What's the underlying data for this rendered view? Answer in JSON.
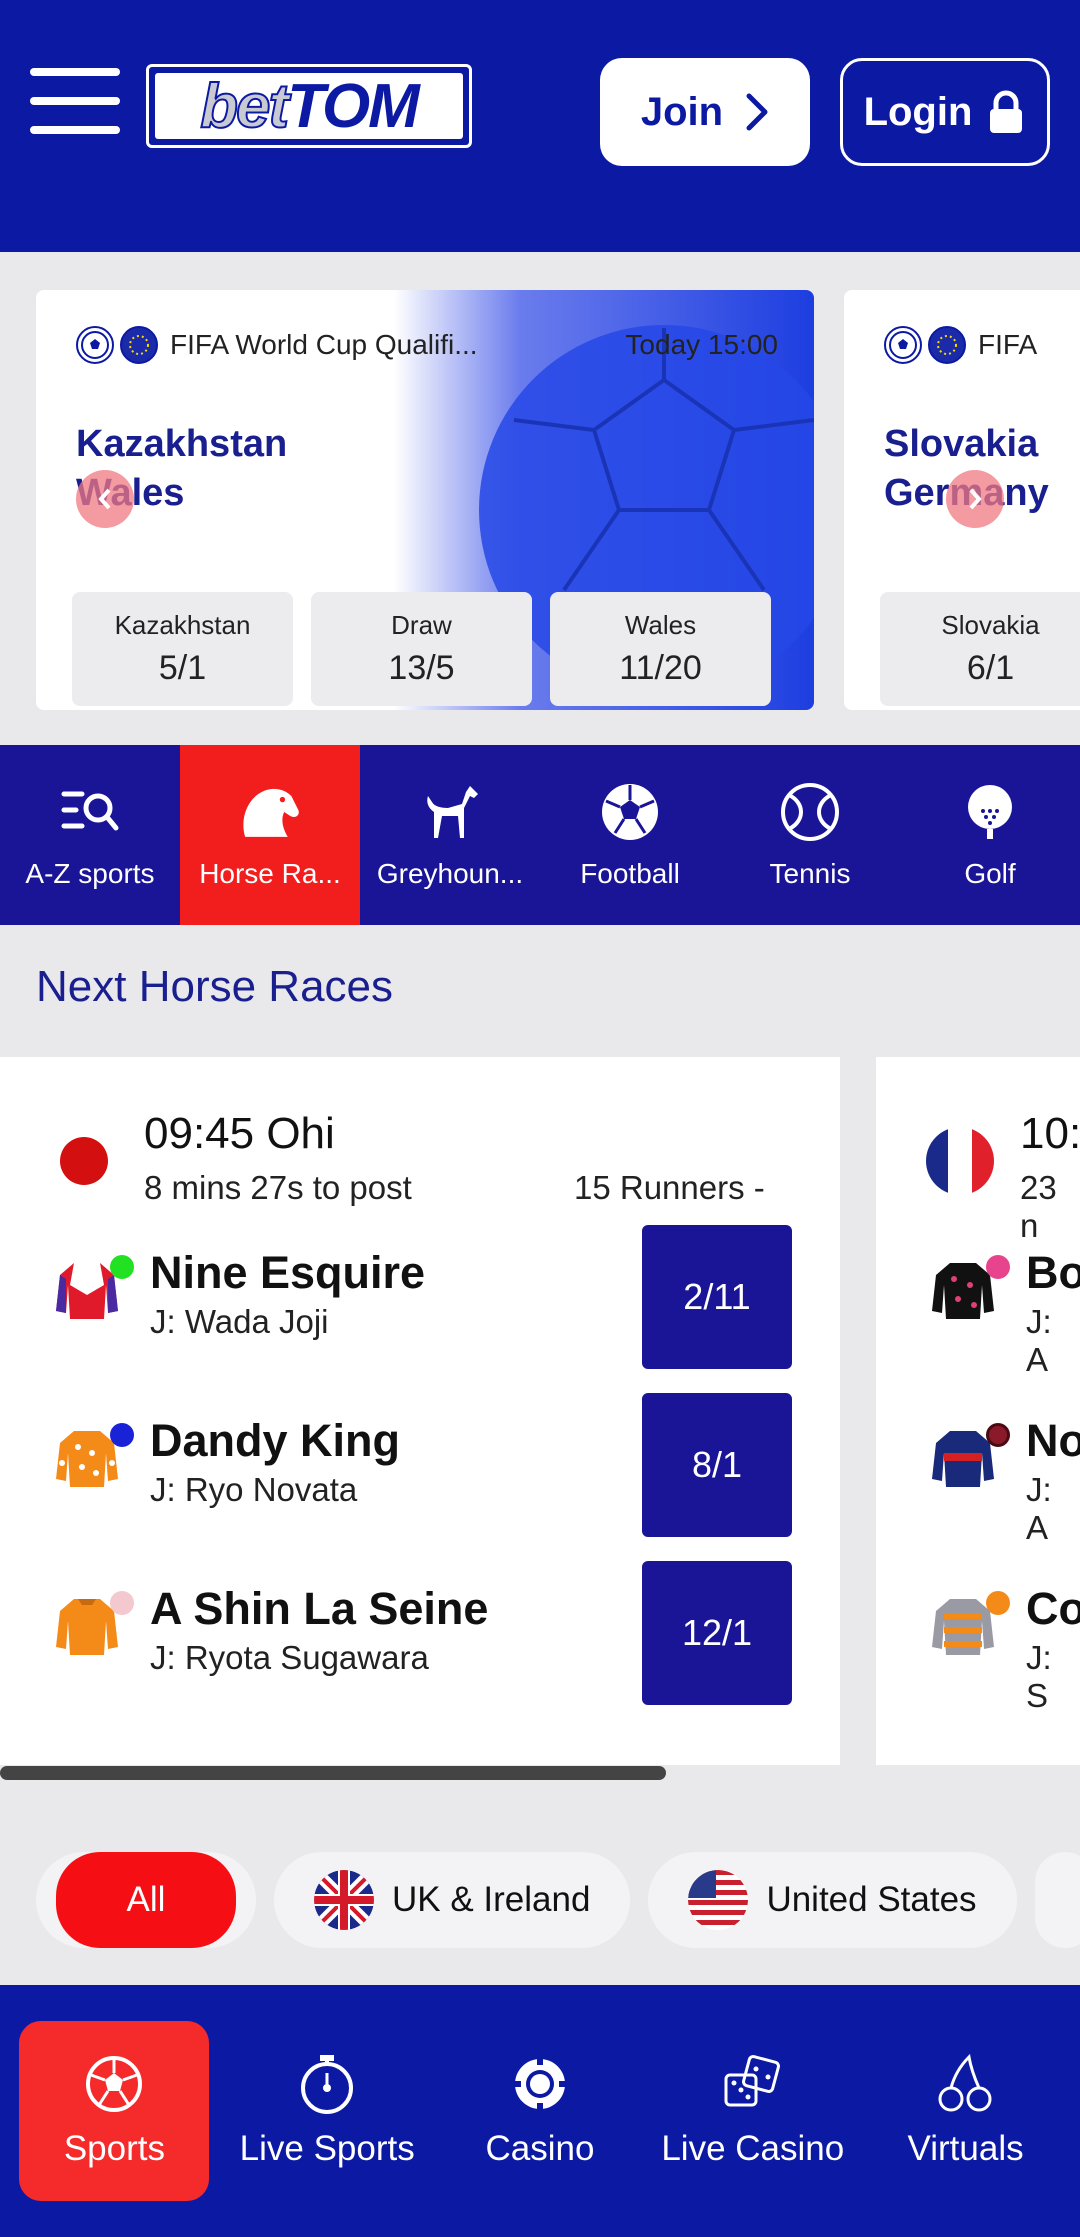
{
  "header": {
    "logo_bet": "bet",
    "logo_tom": "TOM",
    "join_label": "Join",
    "login_label": "Login"
  },
  "carousel": {
    "cards": [
      {
        "competition": "FIFA World Cup Qualifi...",
        "time": "Today 15:00",
        "team_home": "Kazakhstan",
        "team_away": "Wales",
        "odds": [
          {
            "label": "Kazakhstan",
            "value": "5/1"
          },
          {
            "label": "Draw",
            "value": "13/5"
          },
          {
            "label": "Wales",
            "value": "11/20"
          }
        ]
      },
      {
        "competition": "FIFA",
        "team_home": "Slovakia",
        "team_away": "Germany",
        "odds": [
          {
            "label": "Slovakia",
            "value": "6/1"
          }
        ]
      }
    ]
  },
  "sport_nav": [
    {
      "label": "A-Z sports",
      "icon": "az-search-icon"
    },
    {
      "label": "Horse Ra...",
      "icon": "horse-head-icon",
      "active": true
    },
    {
      "label": "Greyhoun...",
      "icon": "greyhound-icon"
    },
    {
      "label": "Football",
      "icon": "football-icon"
    },
    {
      "label": "Tennis",
      "icon": "tennis-ball-icon"
    },
    {
      "label": "Golf",
      "icon": "golf-ball-icon"
    }
  ],
  "next_races": {
    "title": "Next Horse Races",
    "races": [
      {
        "time_venue": "09:45 Ohi",
        "countdown": "8 mins 27s to post",
        "runners_count": "15 Runners  -",
        "runners": [
          {
            "name": "Nine Esquire",
            "jockey": "J: Wada Joji",
            "price": "2/11",
            "dot_color": "#22e022"
          },
          {
            "name": "Dandy King",
            "jockey": "J: Ryo Novata",
            "price": "8/1",
            "dot_color": "#1a22d8"
          },
          {
            "name": "A Shin La Seine",
            "jockey": "J: Ryota Sugawara",
            "price": "12/1",
            "dot_color": "#f4c8cf"
          }
        ]
      },
      {
        "time_venue": "10:",
        "countdown": "23 n",
        "runners": [
          {
            "name": "Bo",
            "jockey": "J: A"
          },
          {
            "name": "No",
            "jockey": "J: A"
          },
          {
            "name": "Co",
            "jockey": "J: S"
          }
        ]
      }
    ]
  },
  "filters": {
    "all": "All",
    "uk": "UK & Ireland",
    "us": "United States"
  },
  "bottom_nav": [
    {
      "label": "Sports",
      "icon": "football-icon",
      "active": true
    },
    {
      "label": "Live Sports",
      "icon": "stopwatch-icon"
    },
    {
      "label": "Casino",
      "icon": "casino-chip-icon"
    },
    {
      "label": "Live Casino",
      "icon": "dice-icon"
    },
    {
      "label": "Virtuals",
      "icon": "cherries-icon"
    }
  ],
  "colors": {
    "brand_blue": "#0c1aa3",
    "nav_blue": "#1a1496",
    "accent_red": "#f21d1d"
  }
}
